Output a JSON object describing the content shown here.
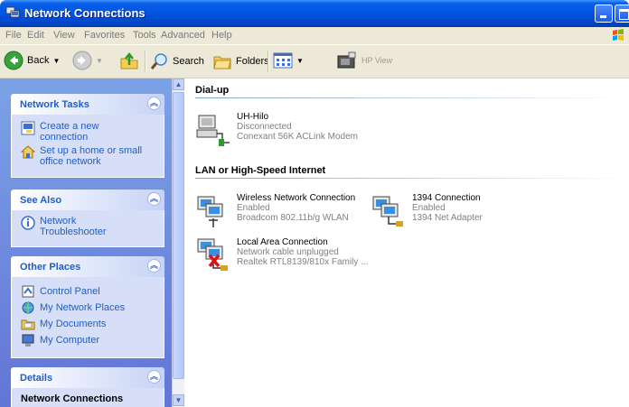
{
  "window": {
    "title": "Network Connections"
  },
  "menu": {
    "items": [
      "File",
      "Edit",
      "View",
      "Favorites",
      "Tools",
      "Advanced",
      "Help"
    ]
  },
  "toolbar": {
    "back_label": "Back",
    "search_label": "Search",
    "folders_label": "Folders",
    "hp_view_label": "HP View"
  },
  "sidebar": {
    "network_tasks": {
      "title": "Network Tasks",
      "items": [
        "Create a new connection",
        "Set up a home or small office network"
      ]
    },
    "see_also": {
      "title": "See Also",
      "items": [
        "Network Troubleshooter"
      ]
    },
    "other_places": {
      "title": "Other Places",
      "items": [
        "Control Panel",
        "My Network Places",
        "My Documents",
        "My Computer"
      ]
    },
    "details": {
      "title": "Details",
      "subtitle": "Network Connections"
    }
  },
  "groups": {
    "dialup": {
      "title": "Dial-up",
      "connections": [
        {
          "name": "UH-Hilo",
          "status": "Disconnected",
          "device": "Conexant 56K ACLink Modem"
        }
      ]
    },
    "lan": {
      "title": "LAN or High-Speed Internet",
      "connections": [
        {
          "name": "Wireless Network Connection",
          "status": "Enabled",
          "device": "Broadcom 802.11b/g WLAN"
        },
        {
          "name": "1394 Connection",
          "status": "Enabled",
          "device": "1394 Net Adapter"
        },
        {
          "name": "Local Area Connection",
          "status": "Network cable unplugged",
          "device": "Realtek RTL8139/810x Family ..."
        }
      ]
    }
  },
  "colors": {
    "title_bar": "#0054e3",
    "task_pane": "#6375d6",
    "task_link": "#215dc6"
  }
}
